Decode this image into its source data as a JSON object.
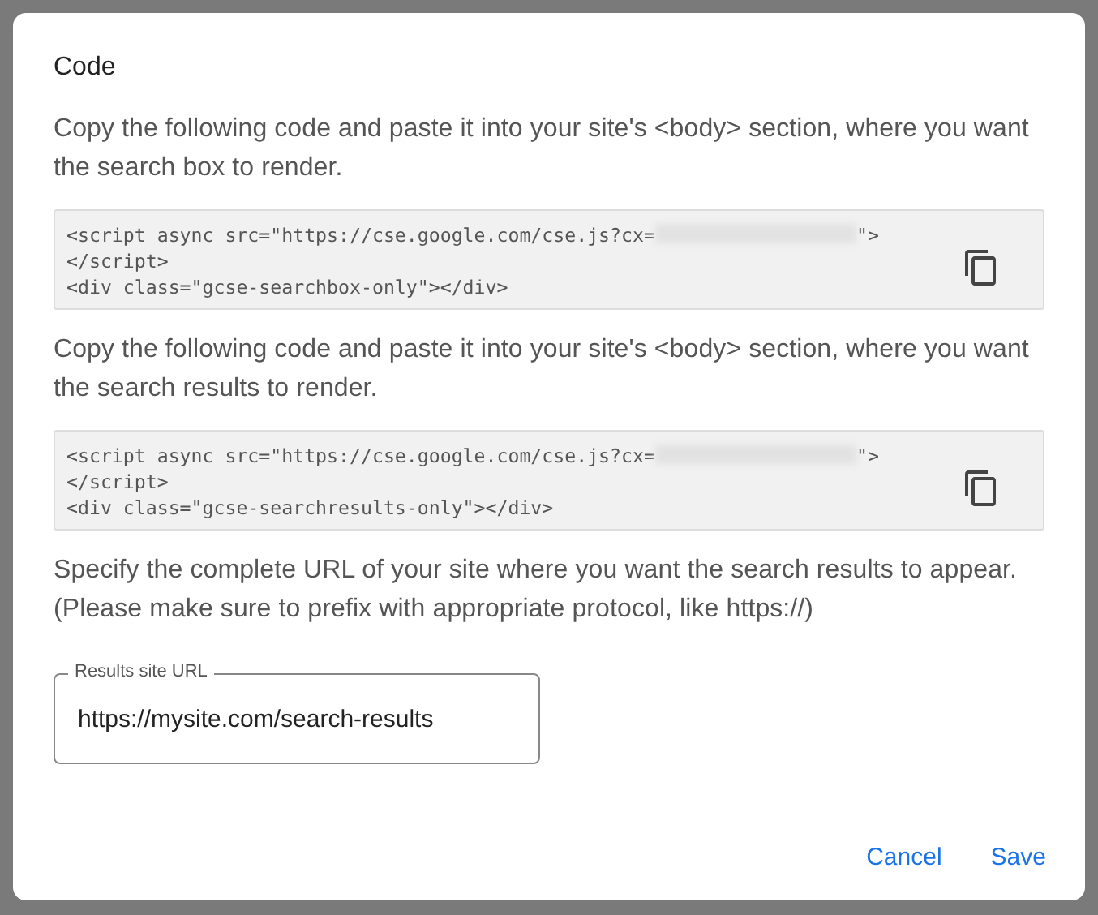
{
  "dialog": {
    "title": "Code",
    "sections": [
      {
        "instruction": "Copy the following code and paste it into your site's <body> section, where you want the search box to render.",
        "code_lines": [
          [
            {
              "kind": "text",
              "text": "<script async src=\"https://cse.google.com/cse.js?cx="
            },
            {
              "kind": "redacted"
            },
            {
              "kind": "text",
              "text": "\">"
            }
          ],
          [
            {
              "kind": "text",
              "text": "</script>"
            }
          ],
          [
            {
              "kind": "text",
              "text": "<div class=\"gcse-searchbox-only\"></div>"
            }
          ]
        ]
      },
      {
        "instruction": "Copy the following code and paste it into your site's <body> section, where you want the search results to render.",
        "code_lines": [
          [
            {
              "kind": "text",
              "text": "<script async src=\"https://cse.google.com/cse.js?cx="
            },
            {
              "kind": "redacted"
            },
            {
              "kind": "text",
              "text": "\">"
            }
          ],
          [
            {
              "kind": "text",
              "text": "</script>"
            }
          ],
          [
            {
              "kind": "text",
              "text": "<div class=\"gcse-searchresults-only\"></div>"
            }
          ]
        ]
      }
    ],
    "url_instruction": "Specify the complete URL of your site where you want the search results to appear. (Please make sure to prefix with appropriate protocol, like https://)",
    "url_field": {
      "label": "Results site URL",
      "value": "https://mysite.com/search-results"
    },
    "buttons": [
      "Cancel",
      "Save"
    ]
  }
}
